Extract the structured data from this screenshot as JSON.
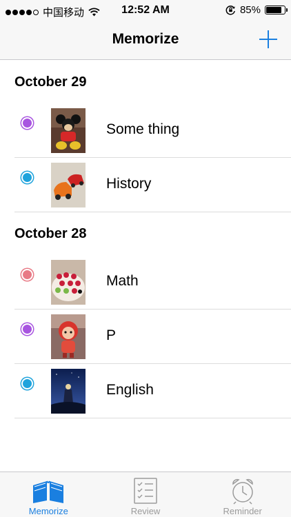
{
  "status_bar": {
    "carrier": "中国移动",
    "time": "12:52 AM",
    "battery": "85%",
    "battery_level": 0.85,
    "signal_bars": 4,
    "signal_total": 5
  },
  "nav": {
    "title": "Memorize",
    "add_icon": "plus-icon",
    "accent": "#1a7fe0"
  },
  "sections": [
    {
      "date": "October 29",
      "items": [
        {
          "title": "Some thing",
          "dot_color": "#a855e0",
          "thumb": "plush-toy-photo"
        },
        {
          "title": "History",
          "dot_color": "#1fa3dc",
          "thumb": "toy-cars-photo"
        }
      ]
    },
    {
      "date": "October 28",
      "items": [
        {
          "title": "Math",
          "dot_color": "#e87a86",
          "thumb": "cake-photo"
        },
        {
          "title": "P",
          "dot_color": "#a855e0",
          "thumb": "plush-doll-photo"
        },
        {
          "title": "English",
          "dot_color": "#1fa3dc",
          "thumb": "night-scene-photo"
        }
      ]
    }
  ],
  "tabs": [
    {
      "label": "Memorize",
      "icon": "open-book-icon",
      "active": true
    },
    {
      "label": "Review",
      "icon": "checklist-icon",
      "active": false
    },
    {
      "label": "Reminder",
      "icon": "alarm-clock-icon",
      "active": false
    }
  ]
}
